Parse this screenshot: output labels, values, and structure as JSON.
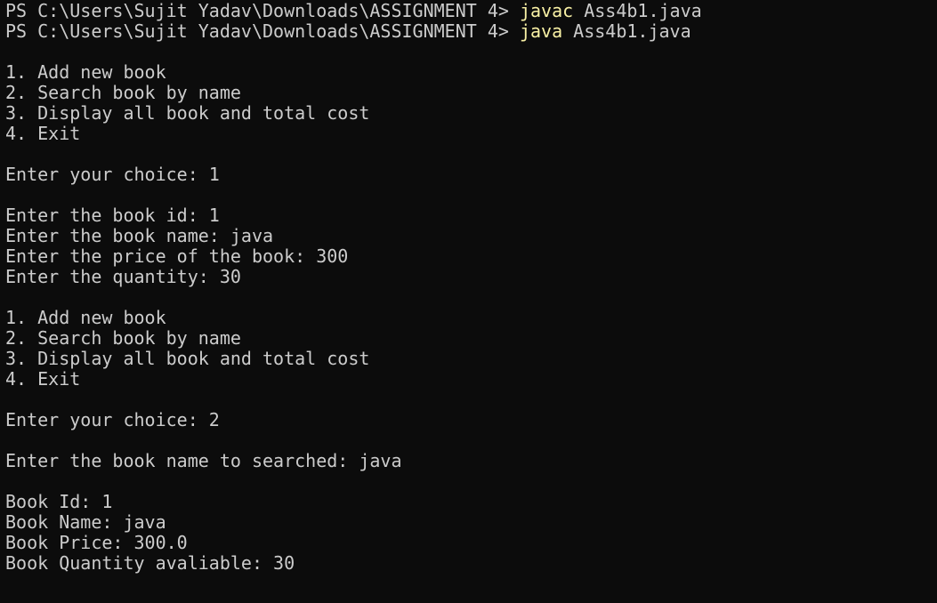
{
  "terminal": {
    "background": "#0c0c0c",
    "foreground": "#cccccc",
    "command_color": "#f9f1a5",
    "prompt": "PS C:\\Users\\Sujit Yadav\\Downloads\\ASSIGNMENT 4> ",
    "compile": {
      "cmd": "javac",
      "args": " Ass4b1.java"
    },
    "run": {
      "cmd": "java",
      "args": " Ass4b1.java"
    },
    "output": [
      "",
      "1. Add new book",
      "2. Search book by name",
      "3. Display all book and total cost",
      "4. Exit",
      "",
      "Enter your choice: 1",
      "",
      "Enter the book id: 1",
      "Enter the book name: java",
      "Enter the price of the book: 300",
      "Enter the quantity: 30",
      "",
      "1. Add new book",
      "2. Search book by name",
      "3. Display all book and total cost",
      "4. Exit",
      "",
      "Enter your choice: 2",
      "",
      "Enter the book name to searched: java",
      "",
      "Book Id: 1",
      "Book Name: java",
      "Book Price: 300.0",
      "Book Quantity avaliable: 30"
    ]
  }
}
